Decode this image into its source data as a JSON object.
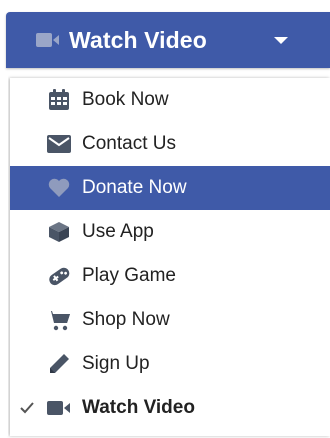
{
  "button": {
    "label": "Watch Video",
    "icon": "video-camera-icon",
    "caret_icon": "caret-down-icon"
  },
  "menu": {
    "items": [
      {
        "label": "Book Now",
        "icon": "calendar-icon"
      },
      {
        "label": "Contact Us",
        "icon": "envelope-icon"
      },
      {
        "label": "Donate Now",
        "icon": "heart-icon",
        "active": true
      },
      {
        "label": "Use App",
        "icon": "cube-icon"
      },
      {
        "label": "Play Game",
        "icon": "gamepad-icon"
      },
      {
        "label": "Shop Now",
        "icon": "shopping-cart-icon"
      },
      {
        "label": "Sign Up",
        "icon": "pencil-icon"
      },
      {
        "label": "Watch Video",
        "icon": "video-camera-icon",
        "selected": true,
        "check_icon": "checkmark-icon"
      }
    ]
  },
  "colors": {
    "accent": "#3f5aa8",
    "icon_dark": "#4a5566",
    "text": "#222222"
  }
}
